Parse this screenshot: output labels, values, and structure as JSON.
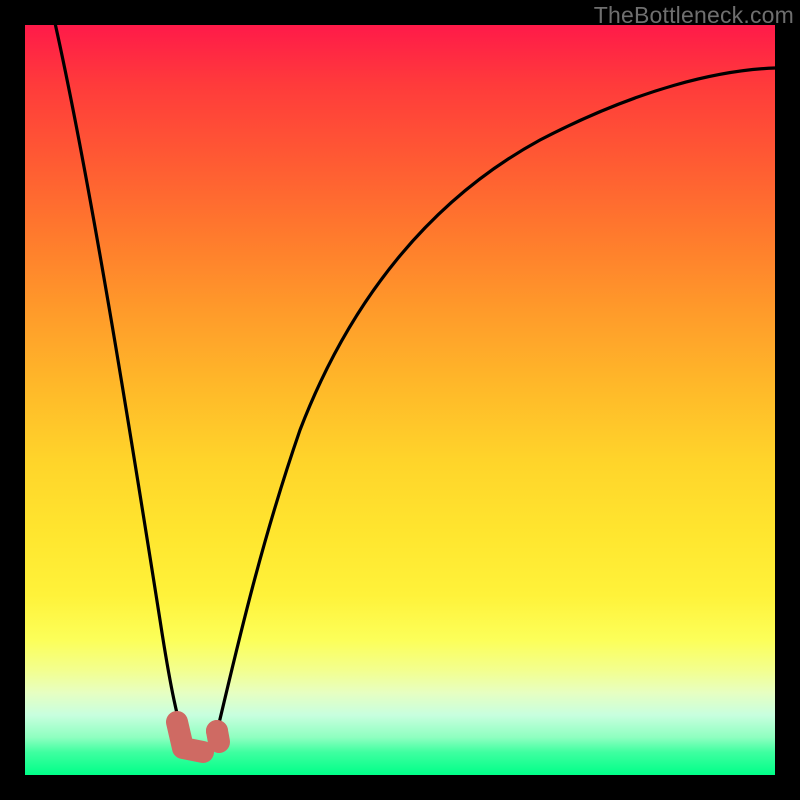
{
  "watermark": "TheBottleneck.com",
  "colors": {
    "marker": "#cf6a63",
    "line": "#000000"
  },
  "chart_data": {
    "type": "line",
    "title": "",
    "xlabel": "",
    "ylabel": "",
    "xlim": [
      0,
      100
    ],
    "ylim": [
      0,
      100
    ],
    "grid": false,
    "legend": false,
    "annotations": [],
    "series": [
      {
        "name": "left-branch",
        "x": [
          4.0,
          6.0,
          8.0,
          10.0,
          12.0,
          14.0,
          16.0,
          17.5,
          19.0,
          20.5
        ],
        "y": [
          100.0,
          85.0,
          71.0,
          57.0,
          44.0,
          32.0,
          21.0,
          13.0,
          6.0,
          2.5
        ]
      },
      {
        "name": "right-branch",
        "x": [
          23.0,
          25.0,
          28.0,
          32.0,
          36.0,
          41.0,
          47.0,
          54.0,
          62.0,
          71.0,
          81.0,
          92.0,
          100.0
        ],
        "y": [
          3.0,
          9.0,
          19.0,
          31.0,
          42.0,
          52.0,
          61.0,
          69.0,
          76.0,
          82.0,
          87.0,
          91.0,
          93.0
        ]
      }
    ],
    "trough": {
      "x": 21.5,
      "y": 2.0
    },
    "markers": [
      {
        "name": "left-marker",
        "x": 19.0,
        "y": 6.0
      },
      {
        "name": "right-marker",
        "x": 23.0,
        "y": 3.0
      }
    ]
  }
}
